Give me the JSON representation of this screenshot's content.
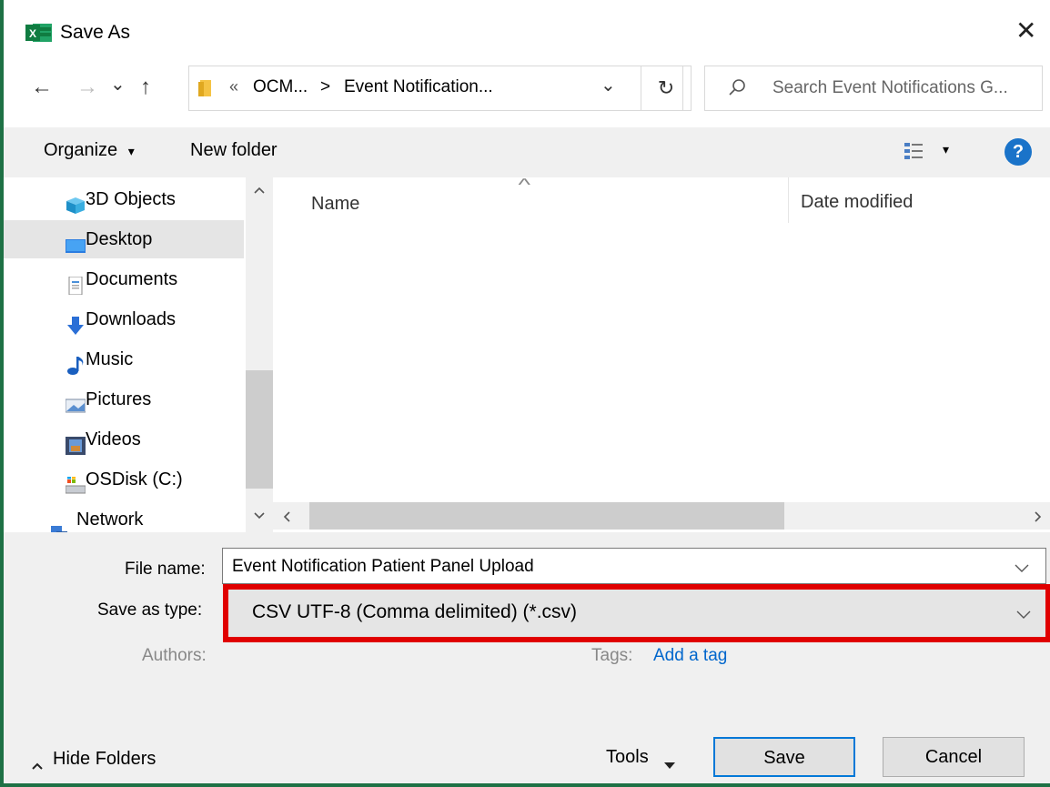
{
  "window": {
    "title": "Save As",
    "app_icon": "excel-icon",
    "close_glyph": "✕"
  },
  "nav": {
    "back": "←",
    "forward": "→",
    "recent": "⌄",
    "up": "↑",
    "refresh": "↻"
  },
  "address": {
    "overflow": "«",
    "segments": [
      "OCM...",
      "Event Notification..."
    ],
    "separator": ">",
    "dropdown": "⌄"
  },
  "search": {
    "placeholder": "Search Event Notifications G..."
  },
  "toolbar": {
    "organize": "Organize",
    "organize_arrow": "▾",
    "new_folder": "New folder",
    "view_arrow": "▾",
    "help": "?"
  },
  "sidebar": {
    "items": [
      {
        "label": "3D Objects",
        "icon": "cube-icon"
      },
      {
        "label": "Desktop",
        "icon": "desktop-icon",
        "selected": true
      },
      {
        "label": "Documents",
        "icon": "documents-icon"
      },
      {
        "label": "Downloads",
        "icon": "download-icon"
      },
      {
        "label": "Music",
        "icon": "music-icon"
      },
      {
        "label": "Pictures",
        "icon": "pictures-icon"
      },
      {
        "label": "Videos",
        "icon": "videos-icon"
      },
      {
        "label": "OSDisk (C:)",
        "icon": "drive-icon"
      },
      {
        "label": "Network",
        "icon": "network-icon"
      }
    ]
  },
  "columns": {
    "name": "Name",
    "date_modified": "Date modified",
    "sort_glyph": "^"
  },
  "form": {
    "file_name_label": "File name:",
    "file_name_value": "Event Notification Patient Panel Upload",
    "save_as_type_label": "Save as type:",
    "save_as_type_value": "CSV UTF-8 (Comma delimited) (*.csv)",
    "authors_label": "Authors:",
    "tags_label": "Tags:",
    "tags_value": "Add a tag"
  },
  "footer": {
    "hide_folders": "Hide Folders",
    "tools": "Tools",
    "save": "Save",
    "cancel": "Cancel"
  },
  "colors": {
    "highlight_border": "#e00000",
    "excel_green": "#1e7145",
    "link_blue": "#0066cc",
    "selected_bg": "#e5e5e5",
    "help_blue": "#1a73c9"
  }
}
